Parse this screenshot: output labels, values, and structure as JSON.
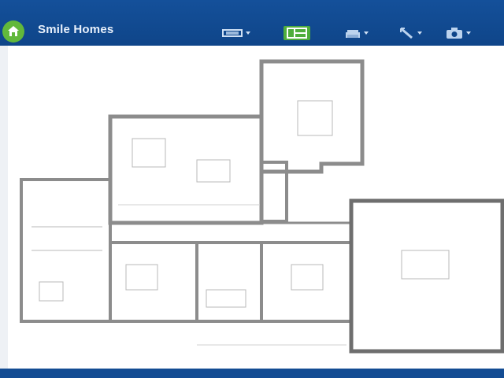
{
  "app": {
    "title": "Smile Homes",
    "logo_icon": "house-leaf-icon"
  },
  "toolbar": {
    "tools": [
      {
        "name": "layers-tool",
        "icon": "layers-icon",
        "has_dropdown": true
      },
      {
        "name": "plan-view-tool",
        "icon": "floorplan-icon",
        "active": true
      },
      {
        "name": "furniture-tool",
        "icon": "sofa-icon",
        "has_dropdown": true
      },
      {
        "name": "measure-tool",
        "icon": "ruler-icon",
        "has_dropdown": true
      },
      {
        "name": "camera-tool",
        "icon": "camera-icon",
        "has_dropdown": true
      }
    ]
  },
  "colors": {
    "header_bg": "#0f4589",
    "accent_green": "#4fae3c",
    "wall": "#8c8c8c",
    "wall_dark": "#6e6e6e",
    "floor": "#ffffff",
    "footer": "#134c93"
  },
  "floorplan": {
    "rooms": [
      {
        "id": "master-bedroom"
      },
      {
        "id": "living-area"
      },
      {
        "id": "dining-area"
      },
      {
        "id": "kitchen"
      },
      {
        "id": "laundry"
      },
      {
        "id": "bathroom"
      },
      {
        "id": "bedroom-2"
      },
      {
        "id": "bedroom-3"
      },
      {
        "id": "bedroom-4"
      },
      {
        "id": "hallway"
      },
      {
        "id": "garage"
      }
    ]
  }
}
